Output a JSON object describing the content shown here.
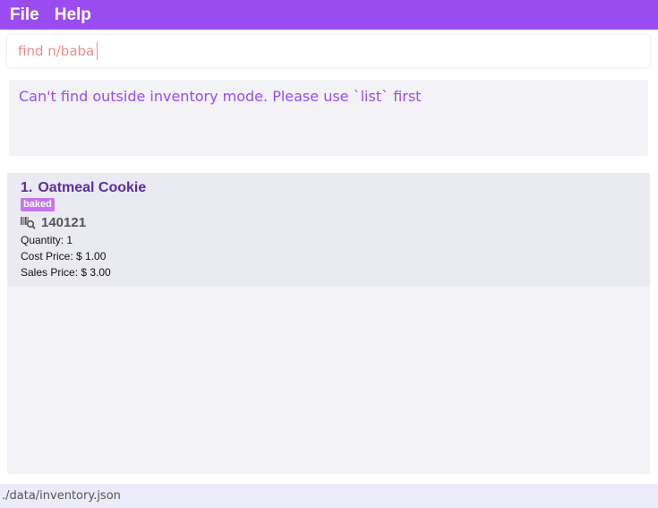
{
  "menu": {
    "file_label": "File",
    "help_label": "Help"
  },
  "command": {
    "value": "find n/baba"
  },
  "result": {
    "message": "Can't find outside inventory mode. Please use `list` first"
  },
  "items": [
    {
      "index": "1.",
      "name": "Oatmeal Cookie",
      "tag": "baked",
      "barcode": "140121",
      "quantity": "Quantity: 1",
      "cost_price": "Cost Price: $ 1.00",
      "sales_price": "Sales Price: $ 3.00"
    }
  ],
  "status": {
    "file_path": "./data/inventory.json"
  },
  "colors": {
    "accent": "#9b4cf0",
    "tag": "#c773f0",
    "title": "#5a2ea0",
    "command_text": "#f08a8a"
  },
  "icons": {
    "barcode": "barcode-scan-icon"
  }
}
